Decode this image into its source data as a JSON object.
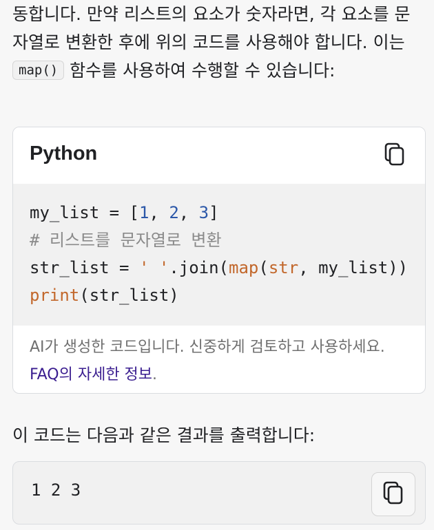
{
  "intro": {
    "before": "동합니다. 만약 리스트의 요소가 숫자라면, 각 요소를 문자열로 변환한 후에 위의 코드를 사용해야 합니다. 이는 ",
    "code": "map()",
    "after": " 함수를 사용하여 수행할 수 있습니다:"
  },
  "code_block": {
    "language": "Python",
    "copy_icon": "copy-icon",
    "lines": {
      "l1_a": "my_list = [",
      "l1_n1": "1",
      "l1_b": ", ",
      "l1_n2": "2",
      "l1_c": ", ",
      "l1_n3": "3",
      "l1_d": "]",
      "l2": "# 리스트를 문자열로 변환",
      "l3_a": "str_list = ",
      "l3_s": "' '",
      "l3_b": ".join(",
      "l3_fn": "map",
      "l3_c": "(",
      "l3_str": "str",
      "l3_d": ", my_list))",
      "l4_fn": "print",
      "l4_a": "(str_list)"
    },
    "footer_text": "AI가 생성한 코드입니다. 신중하게 검토하고 사용하세요. ",
    "footer_link": "FAQ의 자세한 정보",
    "footer_end": "."
  },
  "result_intro": "이 코드는 다음과 같은 결과를 출력합니다:",
  "output_block": {
    "text": "1 2 3",
    "copy_icon": "copy-icon"
  },
  "colors": {
    "number": "#2b57a8",
    "comment": "#8a8a8a",
    "builtin": "#c2672b",
    "link": "#3a1d8f"
  }
}
